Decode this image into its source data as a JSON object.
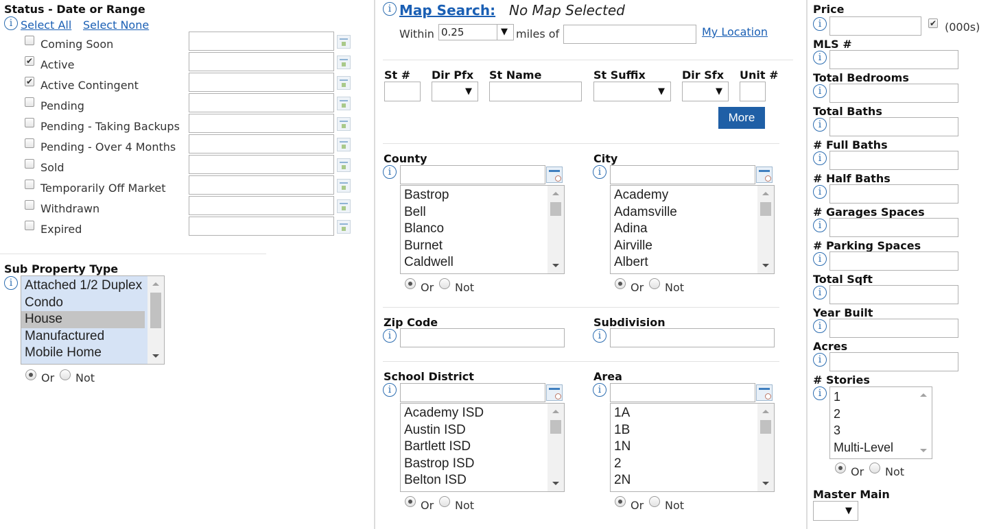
{
  "status": {
    "title": "Status - Date or Range",
    "select_all": "Select All",
    "select_none": "Select None",
    "items": [
      {
        "label": "Coming Soon",
        "checked": false
      },
      {
        "label": "Active",
        "checked": true
      },
      {
        "label": "Active Contingent",
        "checked": true
      },
      {
        "label": "Pending",
        "checked": false
      },
      {
        "label": "Pending - Taking Backups",
        "checked": false
      },
      {
        "label": "Pending - Over 4 Months",
        "checked": false
      },
      {
        "label": "Sold",
        "checked": false
      },
      {
        "label": "Temporarily Off Market",
        "checked": false
      },
      {
        "label": "Withdrawn",
        "checked": false
      },
      {
        "label": "Expired",
        "checked": false
      }
    ]
  },
  "sub_property": {
    "title": "Sub Property Type",
    "options": [
      "Attached 1/2 Duplex",
      "Condo",
      "House",
      "Manufactured",
      "Mobile Home"
    ],
    "or": "Or",
    "not": "Not"
  },
  "map": {
    "title": "Map Search:",
    "status": "No Map Selected",
    "within": "Within",
    "distance": "0.25",
    "miles_of": "miles of",
    "my_location": "My Location"
  },
  "address": {
    "st_num": "St #",
    "dir_pfx": "Dir Pfx",
    "st_name": "St Name",
    "st_suffix": "St Suffix",
    "dir_sfx": "Dir Sfx",
    "unit": "Unit #",
    "more": "More"
  },
  "county": {
    "title": "County",
    "options": [
      "Bastrop",
      "Bell",
      "Blanco",
      "Burnet",
      "Caldwell"
    ],
    "or": "Or",
    "not": "Not"
  },
  "city": {
    "title": "City",
    "options": [
      "Academy",
      "Adamsville",
      "Adina",
      "Airville",
      "Albert"
    ],
    "or": "Or",
    "not": "Not"
  },
  "zip": {
    "title": "Zip Code"
  },
  "subdivision": {
    "title": "Subdivision"
  },
  "school": {
    "title": "School District",
    "options": [
      "Academy ISD",
      "Austin ISD",
      "Bartlett ISD",
      "Bastrop ISD",
      "Belton ISD"
    ],
    "or": "Or",
    "not": "Not"
  },
  "area": {
    "title": "Area",
    "options": [
      "1A",
      "1B",
      "1N",
      "2",
      "2N"
    ],
    "or": "Or",
    "not": "Not"
  },
  "right": {
    "price": "Price",
    "thousands": "(000s)",
    "mls": "MLS #",
    "bedrooms": "Total Bedrooms",
    "baths": "Total Baths",
    "full_baths": "# Full Baths",
    "half_baths": "# Half Baths",
    "garages": "# Garages Spaces",
    "parking": "# Parking Spaces",
    "sqft": "Total Sqft",
    "year_built": "Year Built",
    "acres": "Acres",
    "stories": "# Stories",
    "stories_options": [
      "1",
      "2",
      "3",
      "Multi-Level"
    ],
    "or": "Or",
    "not": "Not",
    "master_main": "Master Main"
  },
  "icons": {
    "info": "info-icon",
    "calendar": "calendar-icon",
    "lookup": "lookup-list-icon"
  },
  "colors": {
    "link": "#1a5fb4",
    "button": "#1f5fa6",
    "selected_option": "#d6e3f5"
  }
}
